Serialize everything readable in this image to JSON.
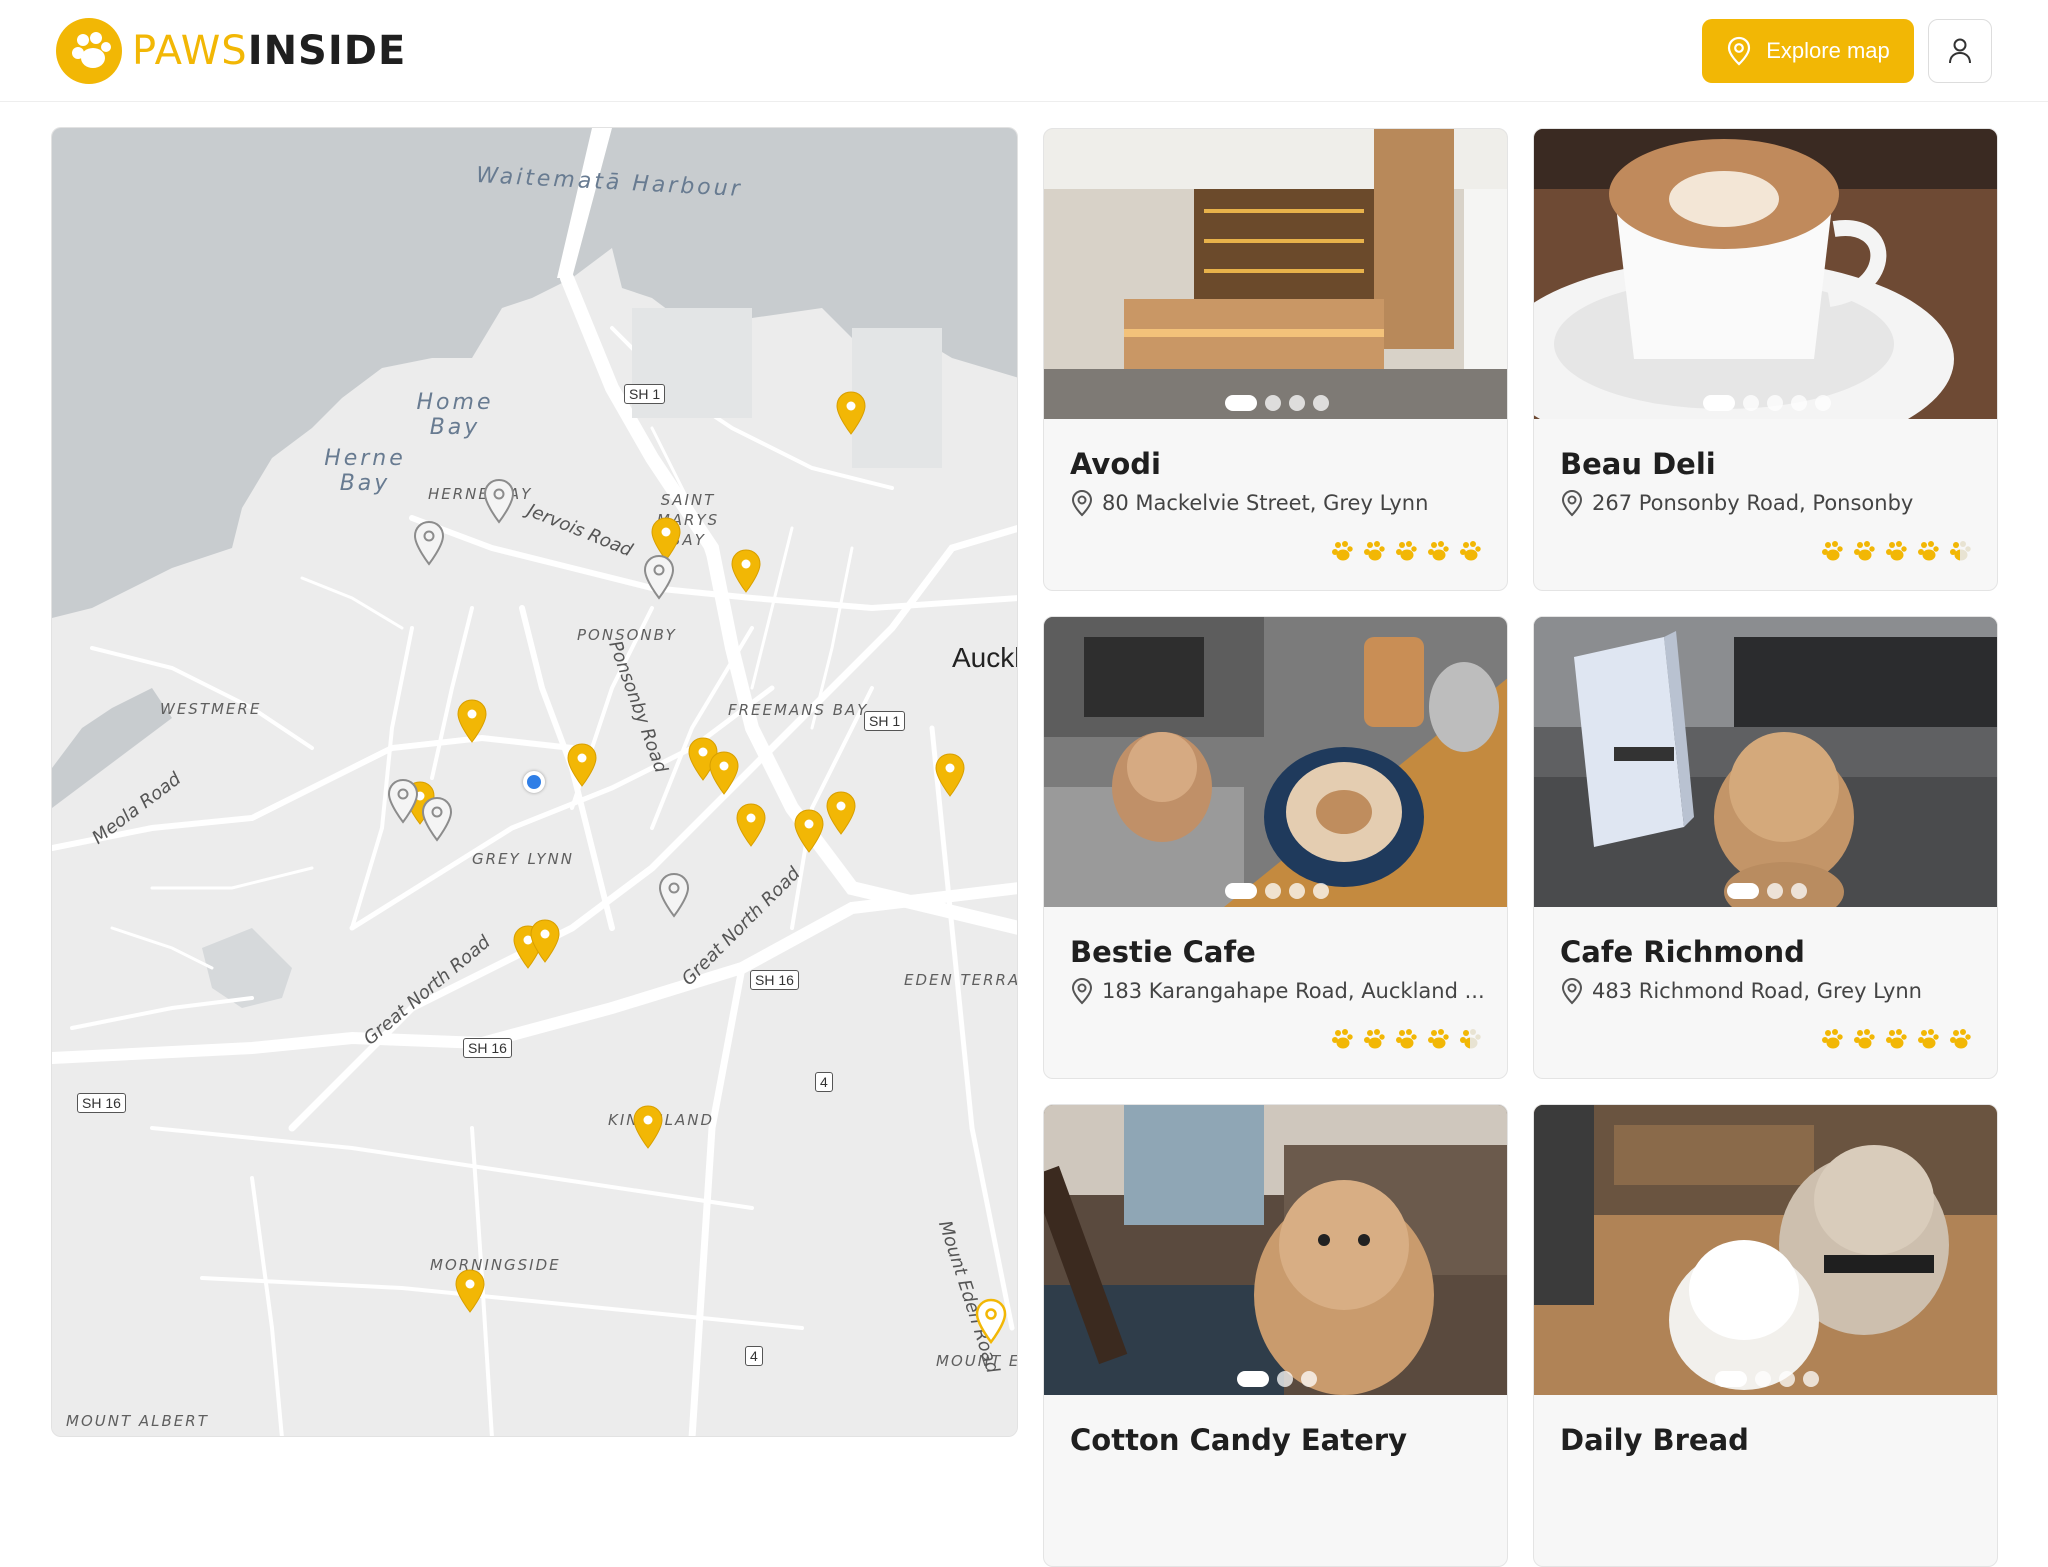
{
  "brand": {
    "part1": "PAWS",
    "part2": "INSIDE",
    "accent": "#f2b705"
  },
  "header": {
    "explore_label": "Explore map"
  },
  "map": {
    "water_labels": [
      "Waitematā Harbour",
      "Home Bay",
      "Herne Bay"
    ],
    "suburb_labels": [
      "HERNE BAY",
      "SAINT MARYS BAY",
      "PONSONBY",
      "WESTMERE",
      "FREEMANS BAY",
      "GREY LYNN",
      "EDEN TERRACE",
      "KINGSLAND",
      "MORNINGSIDE",
      "MOUNT EDEN",
      "MOUNT ALBERT"
    ],
    "road_labels": [
      "Jervois Road",
      "Ponsonby Road",
      "Meola Road",
      "Great North Road",
      "Great North Road",
      "Mount Eden Road"
    ],
    "shields": [
      "SH 1",
      "SH 1",
      "SH 16",
      "SH 16",
      "SH 16",
      "4",
      "4"
    ],
    "city": "Auckl"
  },
  "cafes": [
    {
      "name": "Avodi",
      "address": "80 Mackelvie Street, Grey Lynn",
      "rating": 5,
      "photos": 4
    },
    {
      "name": "Beau Deli",
      "address": "267 Ponsonby Road, Ponsonby",
      "rating": 4.5,
      "photos": 5
    },
    {
      "name": "Bestie Cafe",
      "address": "183 Karangahape Road, Auckland ...",
      "rating": 4.5,
      "photos": 4
    },
    {
      "name": "Cafe Richmond",
      "address": "483 Richmond Road, Grey Lynn",
      "rating": 5,
      "photos": 3
    },
    {
      "name": "Cotton Candy Eatery",
      "address": "",
      "rating": null,
      "photos": 3
    },
    {
      "name": "Daily Bread",
      "address": "",
      "rating": null,
      "photos": 4
    }
  ]
}
